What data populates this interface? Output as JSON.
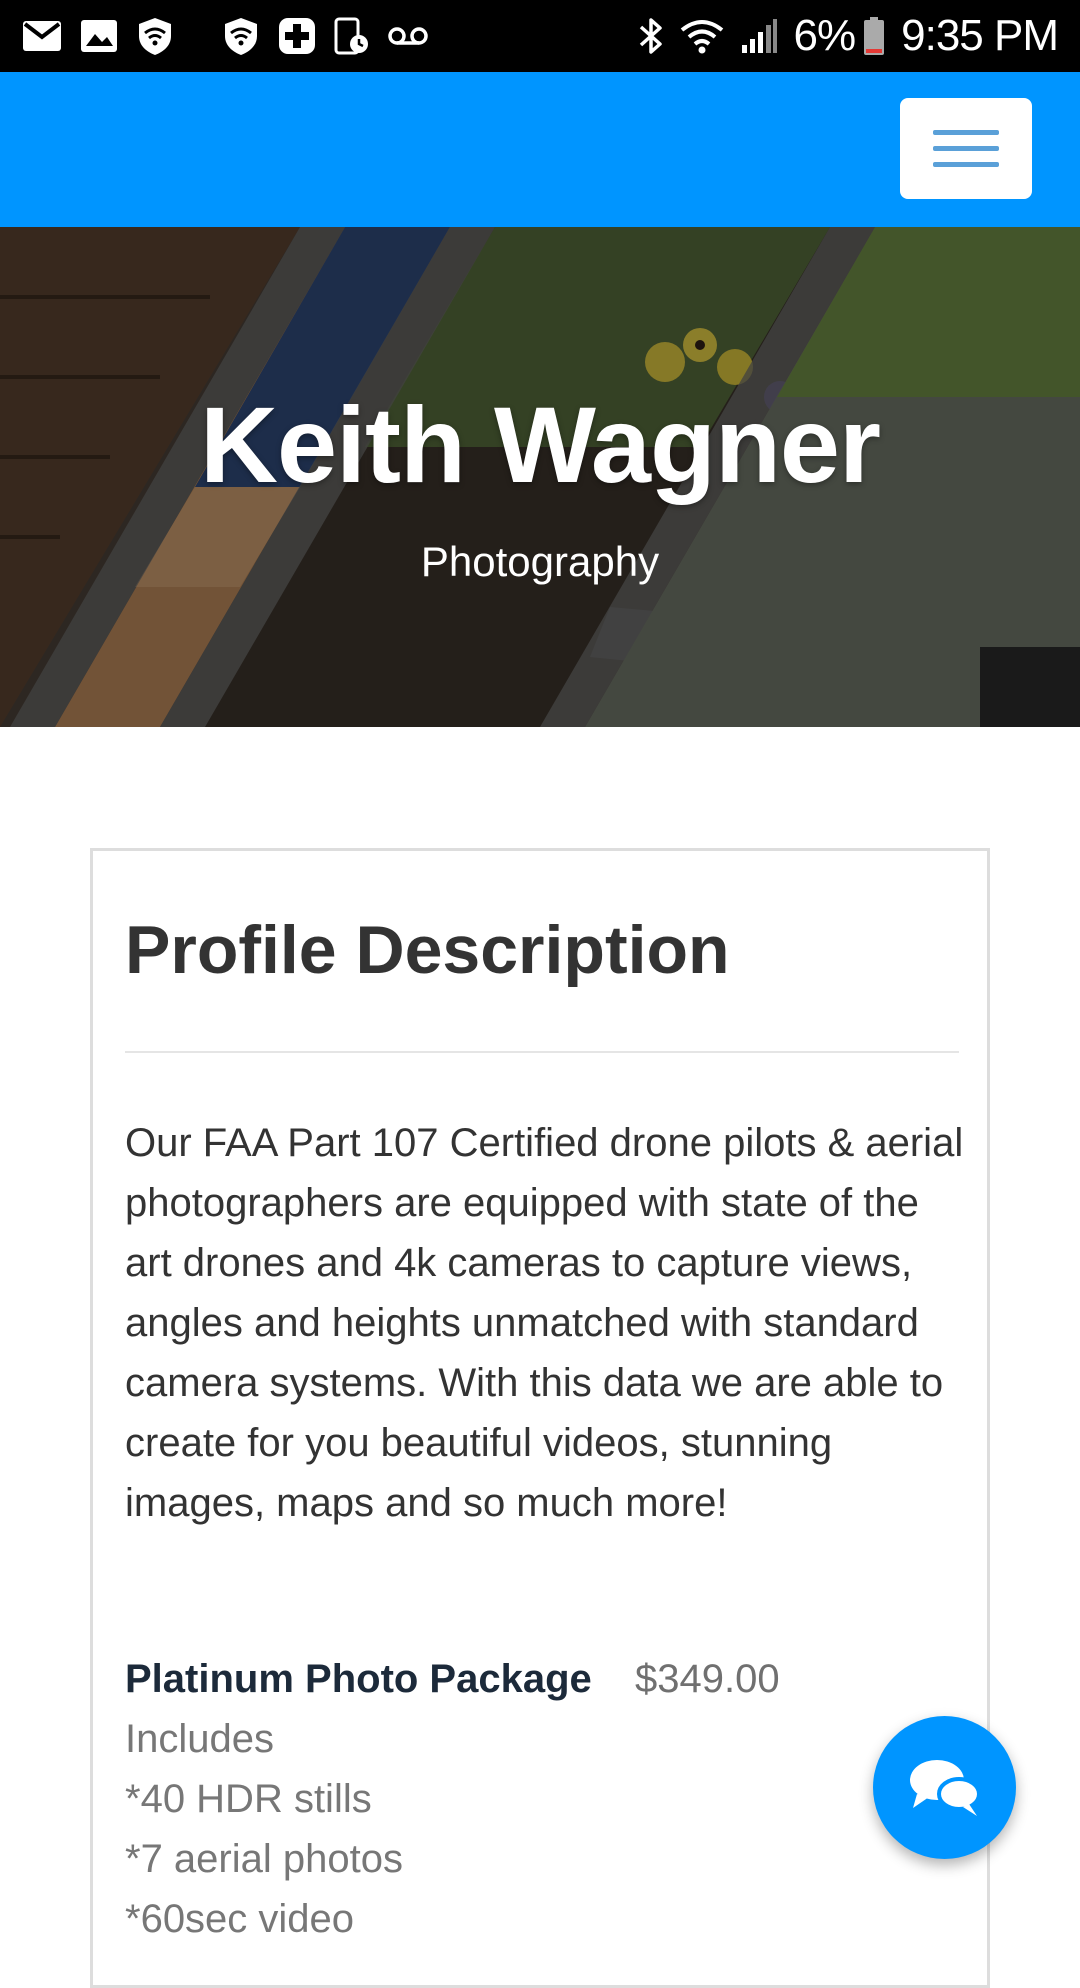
{
  "status_bar": {
    "battery_percent": "6%",
    "time": "9:35 PM",
    "left_icons": [
      "mail-icon",
      "image-icon",
      "shield-icon",
      "shield-icon",
      "medical-cross-icon",
      "device-clock-icon",
      "voicemail-icon"
    ],
    "right_icons": [
      "bluetooth-icon",
      "wifi-icon",
      "signal-icon",
      "battery-icon"
    ]
  },
  "navbar": {
    "menu_icon": "hamburger-menu-icon",
    "color": "#0095ff"
  },
  "hero": {
    "title": "Keith Wagner",
    "subtitle": "Photography"
  },
  "profile": {
    "heading": "Profile Description",
    "description": "Our FAA Part 107 Certified drone pilots & aerial photographers are equipped with state of the art drones and 4k cameras to capture views, angles and heights unmatched with standard camera systems. With this data we are able to create for you beautiful videos, stunning images, maps and so much more!",
    "package": {
      "name": "Platinum Photo Package",
      "price": "$349.00",
      "lines": [
        "Includes",
        "*40 HDR stills",
        "*7 aerial photos",
        "*60sec video"
      ]
    }
  },
  "chat": {
    "icon": "chat-bubbles-icon"
  },
  "colors": {
    "accent": "#0095ff",
    "status_bar": "#000000",
    "heading_text": "#333333",
    "package_title": "#1c2a3a",
    "muted_text": "#777777"
  }
}
